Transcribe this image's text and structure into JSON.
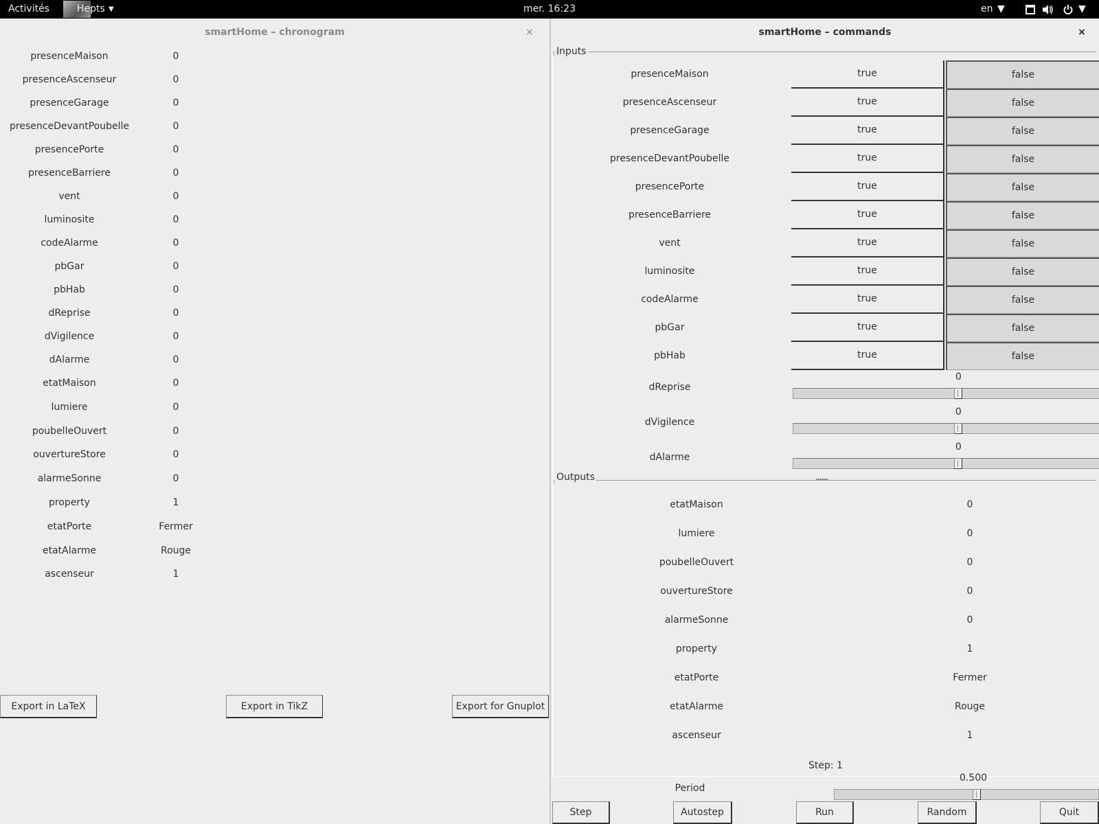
{
  "topbar": {
    "activities": "Activités",
    "app_name": "Hepts",
    "clock": "mer. 16:23",
    "lang": "en",
    "icons": [
      "screen-icon",
      "volume-icon",
      "power-icon"
    ]
  },
  "chrono": {
    "title": "smartHome – chronogram",
    "close": "×",
    "signals": [
      {
        "name": "presenceMaison",
        "value": "0"
      },
      {
        "name": "presenceAscenseur",
        "value": "0"
      },
      {
        "name": "presenceGarage",
        "value": "0"
      },
      {
        "name": "presenceDevantPoubelle",
        "value": "0"
      },
      {
        "name": "presencePorte",
        "value": "0"
      },
      {
        "name": "presenceBarriere",
        "value": "0"
      },
      {
        "name": "vent",
        "value": "0"
      },
      {
        "name": "luminosite",
        "value": "0"
      },
      {
        "name": "codeAlarme",
        "value": "0"
      },
      {
        "name": "pbGar",
        "value": "0"
      },
      {
        "name": "pbHab",
        "value": "0"
      },
      {
        "name": "dReprise",
        "value": "0"
      },
      {
        "name": "dVigilence",
        "value": "0"
      },
      {
        "name": "dAlarme",
        "value": "0"
      },
      {
        "name": "etatMaison",
        "value": "0"
      },
      {
        "name": "lumiere",
        "value": "0"
      },
      {
        "name": "poubelleOuvert",
        "value": "0"
      },
      {
        "name": "ouvertureStore",
        "value": "0"
      },
      {
        "name": "alarmeSonne",
        "value": "0"
      },
      {
        "name": "property",
        "value": "1"
      },
      {
        "name": "etatPorte",
        "value": "Fermer"
      },
      {
        "name": "etatAlarme",
        "value": "Rouge"
      },
      {
        "name": "ascenseur",
        "value": "1"
      }
    ],
    "buttons": {
      "latex": "Export in LaTeX",
      "tikz": "Export in TikZ",
      "gnuplot": "Export for Gnuplot"
    }
  },
  "commands": {
    "title": "smartHome – commands",
    "close": "×",
    "inputs_label": "Inputs",
    "true_label": "true",
    "false_label": "false",
    "bool_inputs": [
      "presenceMaison",
      "presenceAscenseur",
      "presenceGarage",
      "presenceDevantPoubelle",
      "presencePorte",
      "presenceBarriere",
      "vent",
      "luminosite",
      "codeAlarme",
      "pbGar",
      "pbHab"
    ],
    "slider_inputs": [
      {
        "name": "dReprise",
        "value": "0",
        "fraction": 0.54
      },
      {
        "name": "dVigilence",
        "value": "0",
        "fraction": 0.54
      },
      {
        "name": "dAlarme",
        "value": "0",
        "fraction": 0.54
      }
    ],
    "outputs_label": "Outputs",
    "outputs": [
      {
        "name": "etatMaison",
        "value": "0"
      },
      {
        "name": "lumiere",
        "value": "0"
      },
      {
        "name": "poubelleOuvert",
        "value": "0"
      },
      {
        "name": "ouvertureStore",
        "value": "0"
      },
      {
        "name": "alarmeSonne",
        "value": "0"
      },
      {
        "name": "property",
        "value": "1"
      },
      {
        "name": "etatPorte",
        "value": "Fermer"
      },
      {
        "name": "etatAlarme",
        "value": "Rouge"
      },
      {
        "name": "ascenseur",
        "value": "1"
      }
    ],
    "step_label": "Step: 1",
    "period_label": "Period",
    "period_value": "0.500",
    "period_fraction": 0.54,
    "buttons": {
      "step": "Step",
      "autostep": "Autostep",
      "run": "Run",
      "random": "Random",
      "quit": "Quit"
    }
  }
}
